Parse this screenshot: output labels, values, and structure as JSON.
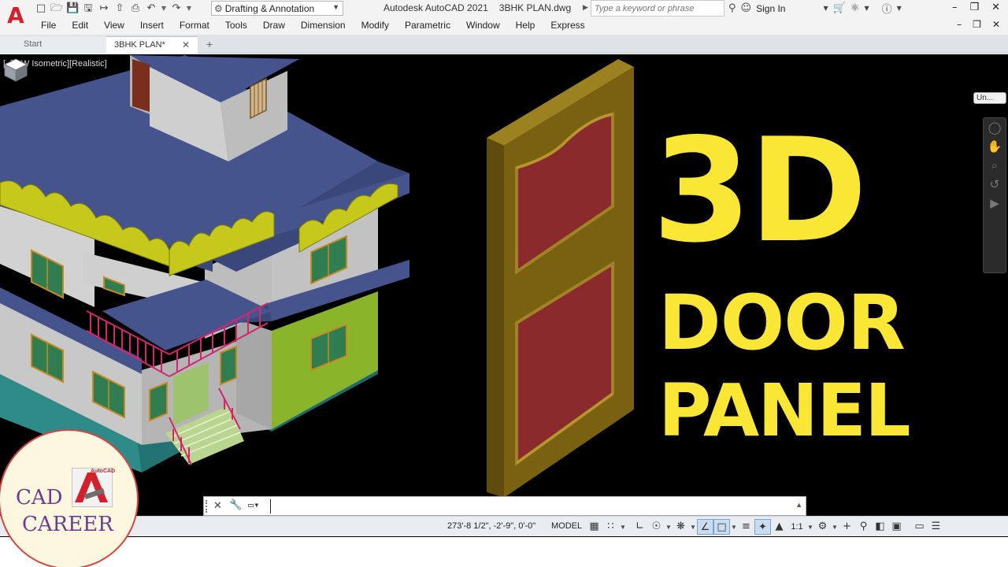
{
  "app": {
    "title": "Autodesk AutoCAD 2021",
    "file": "3BHK PLAN.dwg",
    "logo_letter": "A"
  },
  "quick_access": {
    "workspace": "Drafting & Annotation"
  },
  "search": {
    "placeholder": "Type a keyword or phrase"
  },
  "account": {
    "sign_in": "Sign In"
  },
  "menu": [
    "File",
    "Edit",
    "View",
    "Insert",
    "Format",
    "Tools",
    "Draw",
    "Dimension",
    "Modify",
    "Parametric",
    "Window",
    "Help",
    "Express"
  ],
  "tabs": {
    "start": "Start",
    "active": "3BHK PLAN*"
  },
  "viewport": {
    "label": "[−][SW Isometric][Realistic]",
    "ucs": "Un..."
  },
  "overlay": {
    "line1": "3D",
    "line2": "DOOR",
    "line3": "PANEL"
  },
  "statusbar": {
    "coordinates": "273'-8 1/2\", -2'-9\", 0'-0\"",
    "model": "MODEL",
    "scale": "1:1"
  },
  "watermark": {
    "line1": "CAD",
    "line2": "CAREER",
    "badge": "AutoCAD"
  },
  "colors": {
    "viewport_bg": "#000000",
    "overlay_text": "#f9e635",
    "door_frame": "#7a6112",
    "door_panel": "#8b2a2c",
    "roof": "#45548c",
    "autocad_red": "#d3212c"
  }
}
